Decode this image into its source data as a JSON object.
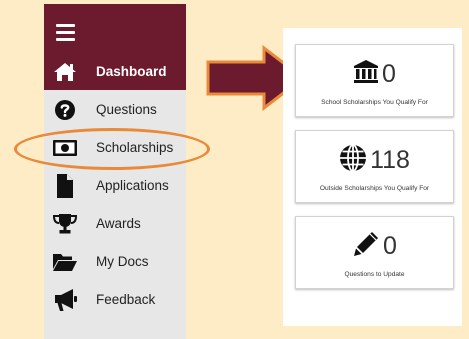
{
  "sidebar": {
    "items": [
      {
        "label": "Dashboard",
        "icon": "home-icon",
        "active": true
      },
      {
        "label": "Questions",
        "icon": "question-circle-icon"
      },
      {
        "label": "Scholarships",
        "icon": "money-bill-icon"
      },
      {
        "label": "Applications",
        "icon": "file-icon"
      },
      {
        "label": "Awards",
        "icon": "trophy-icon"
      },
      {
        "label": "My Docs",
        "icon": "folder-open-icon"
      },
      {
        "label": "Feedback",
        "icon": "bullhorn-icon"
      }
    ]
  },
  "cards": [
    {
      "icon": "institution-icon",
      "value": "0",
      "caption": "School Scholarships You Qualify For"
    },
    {
      "icon": "globe-icon",
      "value": "118",
      "caption": "Outside Scholarships You Qualify For"
    },
    {
      "icon": "pencil-icon",
      "value": "0",
      "caption": "Questions to Update"
    }
  ],
  "colors": {
    "background": "#fdecc6",
    "sidebar_brand": "#6c1b2f",
    "sidebar_bg": "#e7e7e7",
    "highlight": "#e88a3a",
    "arrow_fill": "#6c1b2f",
    "arrow_stroke": "#e88a3a"
  }
}
